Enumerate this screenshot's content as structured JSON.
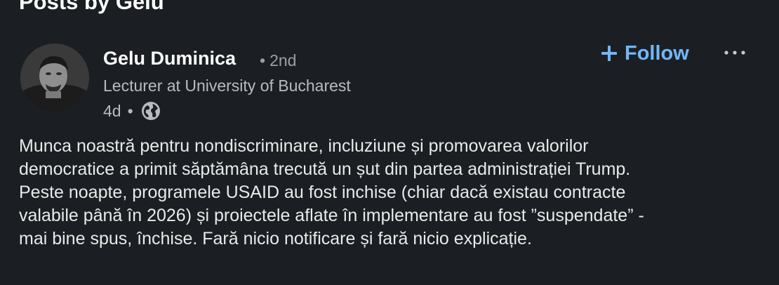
{
  "section": {
    "title": "Posts by Gelu"
  },
  "post": {
    "author": {
      "name": "Gelu Duminica",
      "degree": "2nd",
      "headline": "Lecturer at University of Bucharest"
    },
    "time": "4d",
    "visibility_icon": "globe-icon",
    "follow_label": "Follow",
    "follow_icon": "plus-icon",
    "more_icon": "ellipsis-icon",
    "text": "Munca noastră pentru nondiscriminare, incluziune și promovarea valorilor\ndemocratice a primit săptămâna trecută un șut din partea administrației Trump.\nPeste noapte, programele USAID au fost inchise (chiar dacă existau contracte\nvalabile până în 2026) și proiectele aflate în implementare au fost ”suspendate” -\nmai bine spus, închise. Fară nicio notificare și fară nicio explicație."
  },
  "colors": {
    "background": "#1b1f23",
    "accent": "#71b7fb",
    "primary_text": "#e9e9e9",
    "secondary_text": "#b8bcc0"
  }
}
